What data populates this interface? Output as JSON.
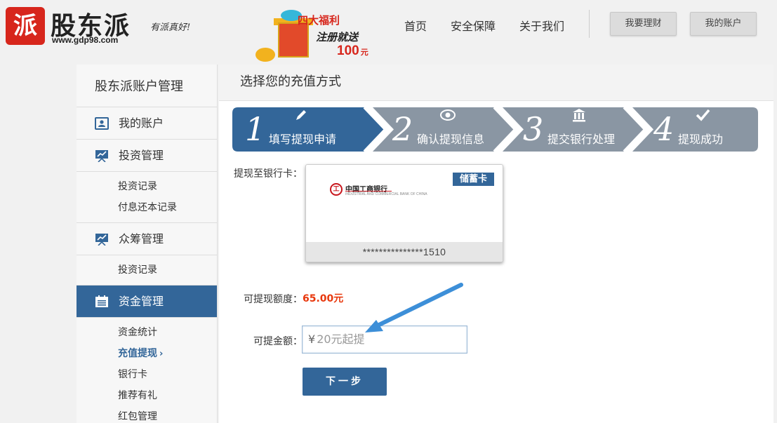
{
  "header": {
    "logo_mark": "派",
    "logo_name": "股东派",
    "logo_url": "www.gdp98.com",
    "slogan": "有派真好!",
    "promo": {
      "line1": "四大福利",
      "line2": "注册就送",
      "amount": "100",
      "unit": "元"
    },
    "nav": [
      "首页",
      "安全保障",
      "关于我们"
    ],
    "buttons": [
      "我要理财",
      "我的账户"
    ]
  },
  "sidebar": {
    "title": "股东派账户管理",
    "sections": [
      {
        "label": "我的账户",
        "icon": "id-card-icon",
        "items": []
      },
      {
        "label": "投资管理",
        "icon": "chart-board-icon",
        "items": [
          "投资记录",
          "付息还本记录"
        ]
      },
      {
        "label": "众筹管理",
        "icon": "chart-board-icon",
        "items": [
          "投资记录"
        ]
      },
      {
        "label": "资金管理",
        "icon": "calendar-icon",
        "items": [
          "资金统计",
          "充值提现",
          "银行卡",
          "推荐有礼",
          "红包管理"
        ],
        "active": true
      }
    ],
    "current_item": "充值提现",
    "current_chevron": "›"
  },
  "main": {
    "title": "选择您的充值方式",
    "steps": [
      {
        "num": "1",
        "label": "填写提现申请",
        "icon": "pencil-icon",
        "active": true
      },
      {
        "num": "2",
        "label": "确认提现信息",
        "icon": "eye-icon",
        "active": false
      },
      {
        "num": "3",
        "label": "提交银行处理",
        "icon": "bank-building-icon",
        "active": false
      },
      {
        "num": "4",
        "label": "提现成功",
        "icon": "checkmark-icon",
        "active": false
      }
    ],
    "card_label": "提现至银行卡：",
    "card": {
      "badge": "储蓄卡",
      "bank_logo_glyph": "工",
      "bank_name": "中国工商银行",
      "bank_en": "INDUSTRIAL AND COMMERCIAL BANK OF CHINA",
      "number": "***************1510"
    },
    "available_label": "可提现额度：",
    "available_value": "65.00元",
    "amount_label": "可提金额：",
    "amount_currency": "¥",
    "amount_placeholder": "20元起提",
    "next_button": "下一步"
  },
  "colors": {
    "accent": "#336699",
    "step_inactive": "#8a96a3",
    "amount_red": "#e8380d",
    "arrow_blue": "#3d8fd8"
  }
}
